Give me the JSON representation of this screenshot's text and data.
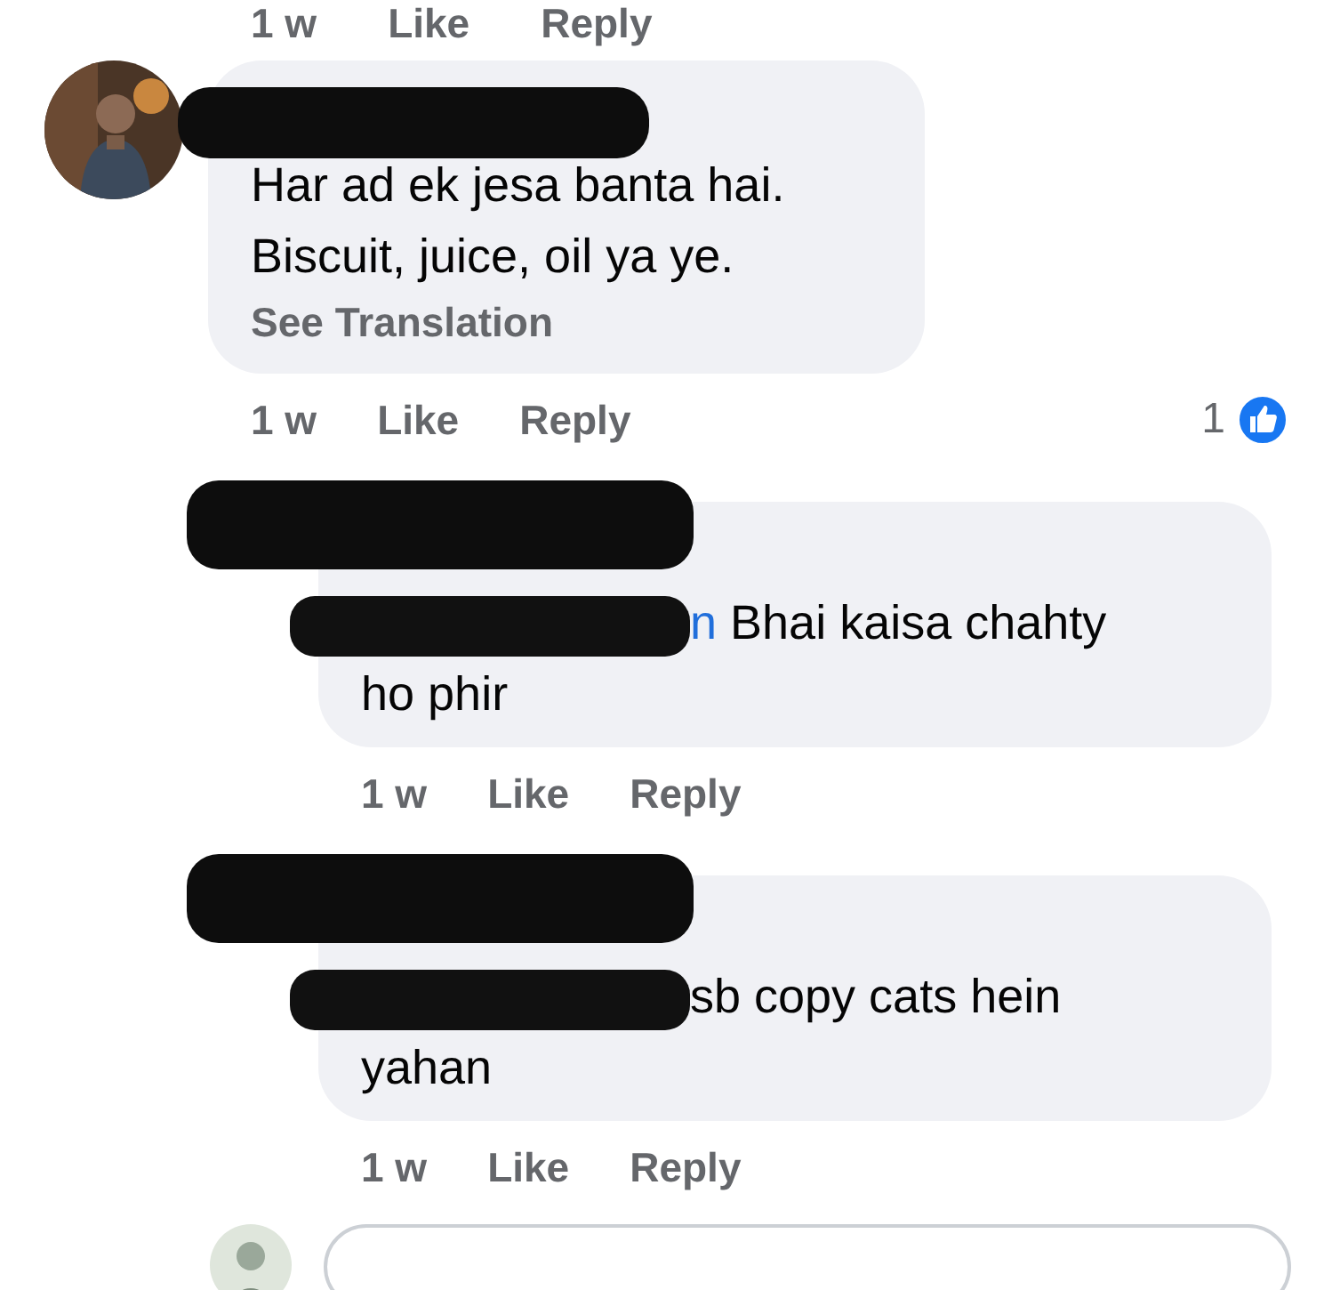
{
  "top_actions": {
    "time": "1 w",
    "like": "Like",
    "reply": "Reply"
  },
  "comments": [
    {
      "kind": "comment",
      "name_redacted": true,
      "lines": [
        "Har ad ek jesa banta hai.",
        "Biscuit, juice, oil ya ye."
      ],
      "translation": "See Translation",
      "time": "1 w",
      "like": "Like",
      "reply": "Reply",
      "reaction_count": "1"
    },
    {
      "kind": "reply",
      "name_redacted": true,
      "mention_redacted": true,
      "mention": "n",
      "lines": [
        " Bhai kaisa chahty",
        "ho phir"
      ],
      "time": "1 w",
      "like": "Like",
      "reply": "Reply"
    },
    {
      "kind": "reply",
      "name_redacted": true,
      "mention_redacted": true,
      "lines": [
        "sb copy cats hein",
        "yahan"
      ],
      "time": "1 w",
      "like": "Like",
      "reply": "Reply"
    }
  ],
  "composer": {
    "kind": "field"
  }
}
